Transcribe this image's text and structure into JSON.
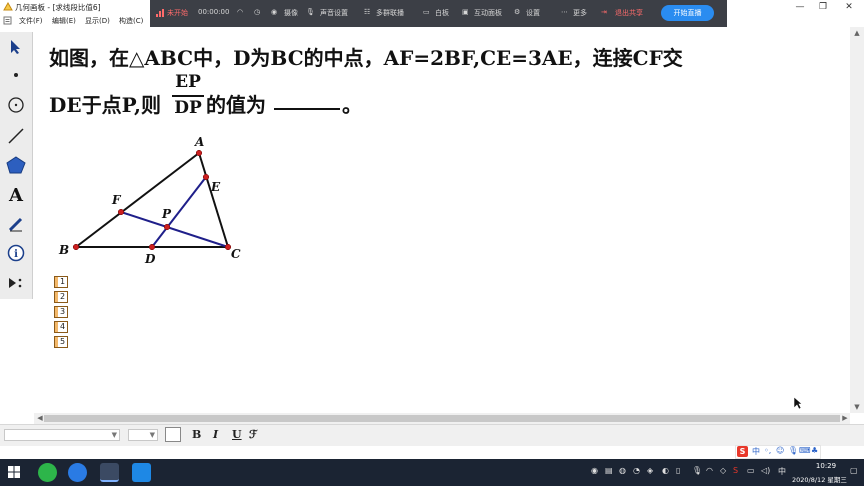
{
  "titlebar": {
    "title": "几何画板 - [求线段比值6]",
    "minimize": "—",
    "restore": "❐",
    "close": "✕"
  },
  "menu": {
    "items": [
      "文件(F)",
      "编辑(E)",
      "显示(D)",
      "构造(C)"
    ]
  },
  "livebar": {
    "status": "未开始",
    "timer": "00:00:00",
    "items": [
      "摄像",
      "声音设置",
      "多群联播",
      "白板",
      "互动面板",
      "设置",
      "更多"
    ],
    "exit": "退出共享",
    "start": "开始直播",
    "colors": {
      "background": "#3c3f46",
      "start_button": "#2a8cf0",
      "alert": "#ff6b6b"
    }
  },
  "toolbox": {
    "tools": [
      "arrow-select-icon",
      "point-icon",
      "compass-icon",
      "line-icon",
      "polygon-icon",
      "text-icon",
      "marker-icon",
      "info-icon",
      "custom-tool-icon"
    ]
  },
  "question": {
    "line1": "如图，在△ABC中，D为BC的中点，AF=2BF,CE=3AE，连接CF交",
    "line2_prefix": "DE于点P,则",
    "fraction_numerator": "EP",
    "fraction_denominator": "DP",
    "line2_suffix": "的值为",
    "period": "。"
  },
  "figure": {
    "labels": {
      "A": "A",
      "B": "B",
      "C": "C",
      "D": "D",
      "E": "E",
      "F": "F",
      "P": "P"
    },
    "colors": {
      "triangle": "#111111",
      "cevians": "#1f1f8a",
      "points": "#cc1f1f"
    }
  },
  "pages": [
    "1",
    "2",
    "3",
    "4",
    "5"
  ],
  "formatbar": {
    "bold": "B",
    "italic": "I",
    "underline": "U",
    "symbol": "ℱ"
  },
  "ime": {
    "logo": "S",
    "lang": "中"
  },
  "taskbar": {
    "time": "10:29",
    "date": "2020/8/12 星期三"
  }
}
